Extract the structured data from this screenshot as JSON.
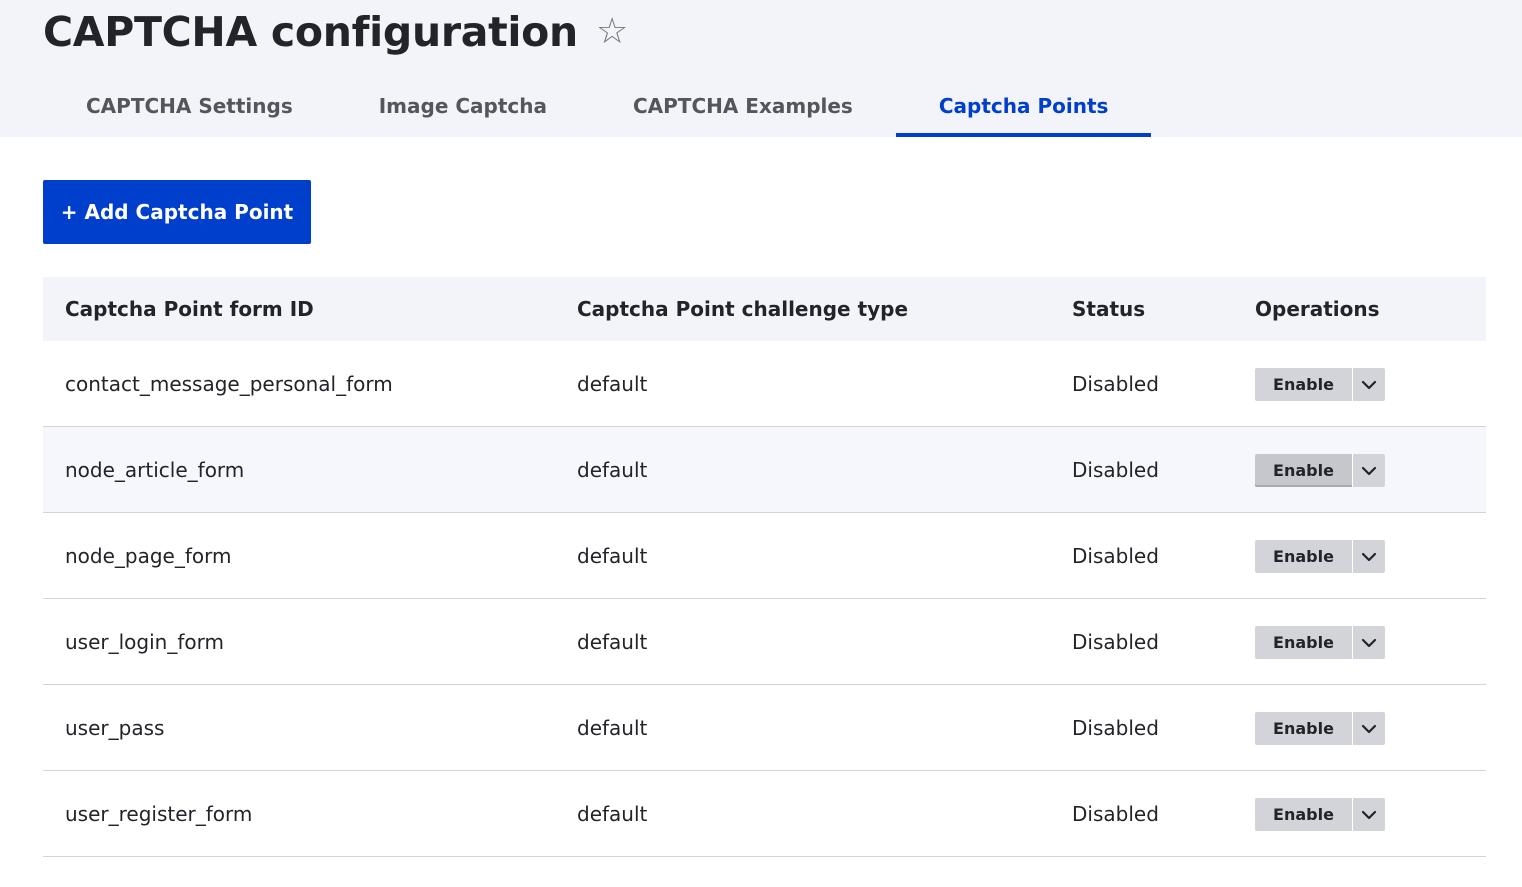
{
  "header": {
    "title": "CAPTCHA configuration",
    "star_glyph": "☆"
  },
  "tabs": [
    {
      "label": "CAPTCHA Settings",
      "active": false
    },
    {
      "label": "Image Captcha",
      "active": false
    },
    {
      "label": "CAPTCHA Examples",
      "active": false
    },
    {
      "label": "Captcha Points",
      "active": true
    }
  ],
  "actions": {
    "add_label": "+ Add Captcha Point"
  },
  "table": {
    "columns": [
      "Captcha Point form ID",
      "Captcha Point challenge type",
      "Status",
      "Operations"
    ],
    "rows": [
      {
        "form_id": "contact_message_personal_form",
        "challenge_type": "default",
        "status": "Disabled",
        "operation": "Enable"
      },
      {
        "form_id": "node_article_form",
        "challenge_type": "default",
        "status": "Disabled",
        "operation": "Enable"
      },
      {
        "form_id": "node_page_form",
        "challenge_type": "default",
        "status": "Disabled",
        "operation": "Enable"
      },
      {
        "form_id": "user_login_form",
        "challenge_type": "default",
        "status": "Disabled",
        "operation": "Enable"
      },
      {
        "form_id": "user_pass",
        "challenge_type": "default",
        "status": "Disabled",
        "operation": "Enable"
      },
      {
        "form_id": "user_register_form",
        "challenge_type": "default",
        "status": "Disabled",
        "operation": "Enable"
      }
    ]
  },
  "colors": {
    "accent": "#003ecc",
    "header_bg": "#f3f4f9",
    "button_bg": "#d3d4d9",
    "row_hover_bg": "#f5f7fd"
  },
  "icons": {
    "favorite": "star-outline-icon",
    "dropdown": "chevron-down-icon"
  }
}
